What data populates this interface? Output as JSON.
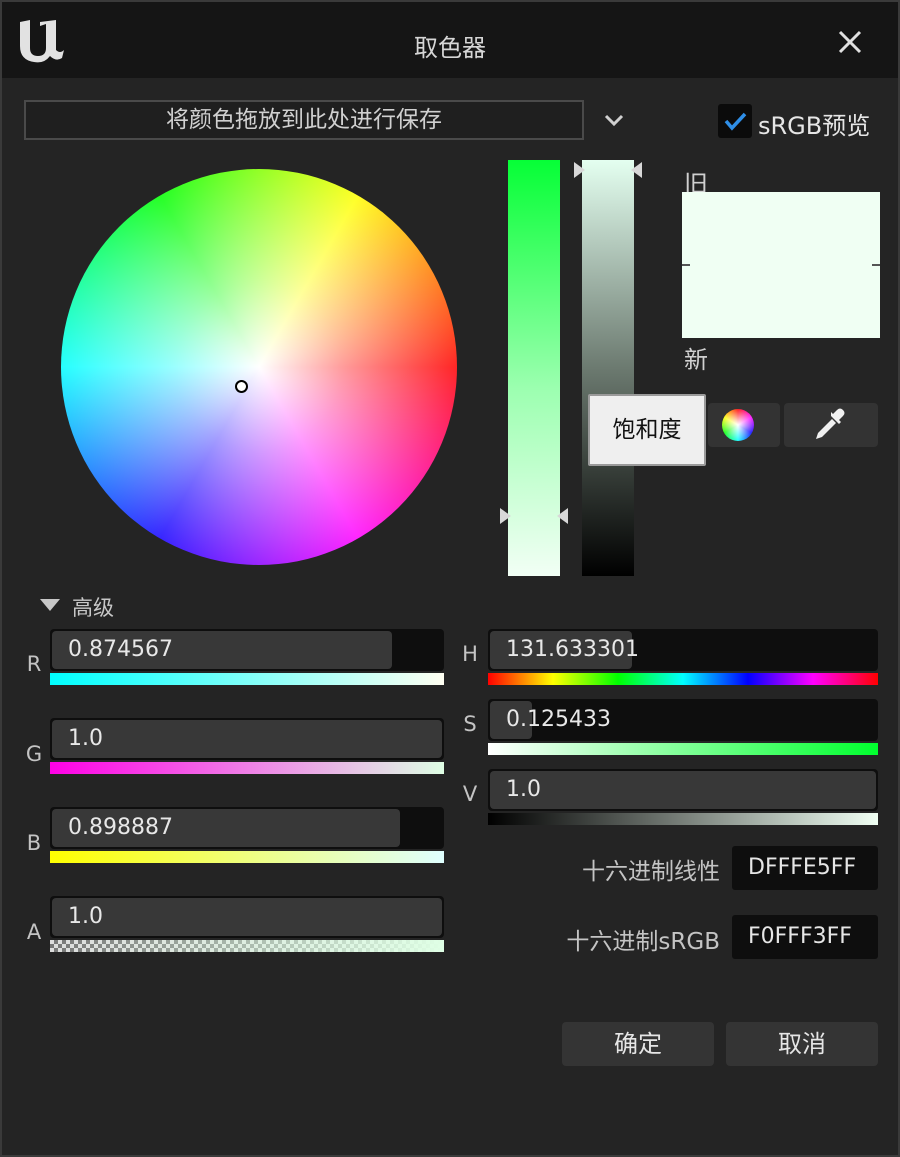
{
  "window": {
    "title": "取色器"
  },
  "toolbar": {
    "drop_hint": "将颜色拖放到此处进行保存",
    "srgb_preview_label": "sRGB预览",
    "srgb_preview_checked": true
  },
  "preview": {
    "old_label": "旧",
    "new_label": "新",
    "color": "#F0FFF3"
  },
  "tooltip": {
    "text": "饱和度"
  },
  "advanced": {
    "label": "高级"
  },
  "rgba": [
    {
      "label": "R",
      "value": "0.874567"
    },
    {
      "label": "G",
      "value": "1.0"
    },
    {
      "label": "B",
      "value": "0.898887"
    },
    {
      "label": "A",
      "value": "1.0"
    }
  ],
  "hsv": [
    {
      "label": "H",
      "value": "131.633301"
    },
    {
      "label": "S",
      "value": "0.125433"
    },
    {
      "label": "V",
      "value": "1.0"
    }
  ],
  "hex": [
    {
      "label": "十六进制线性",
      "value": "DFFFE5FF"
    },
    {
      "label": "十六进制sRGB",
      "value": "F0FFF3FF"
    }
  ],
  "buttons": {
    "ok": "确定",
    "cancel": "取消"
  },
  "icons": [
    "unreal-logo-icon",
    "close-icon",
    "chevron-down-icon",
    "checkbox-check-icon",
    "color-wheel-icon",
    "eyedropper-icon",
    "disclosure-triangle-icon"
  ]
}
